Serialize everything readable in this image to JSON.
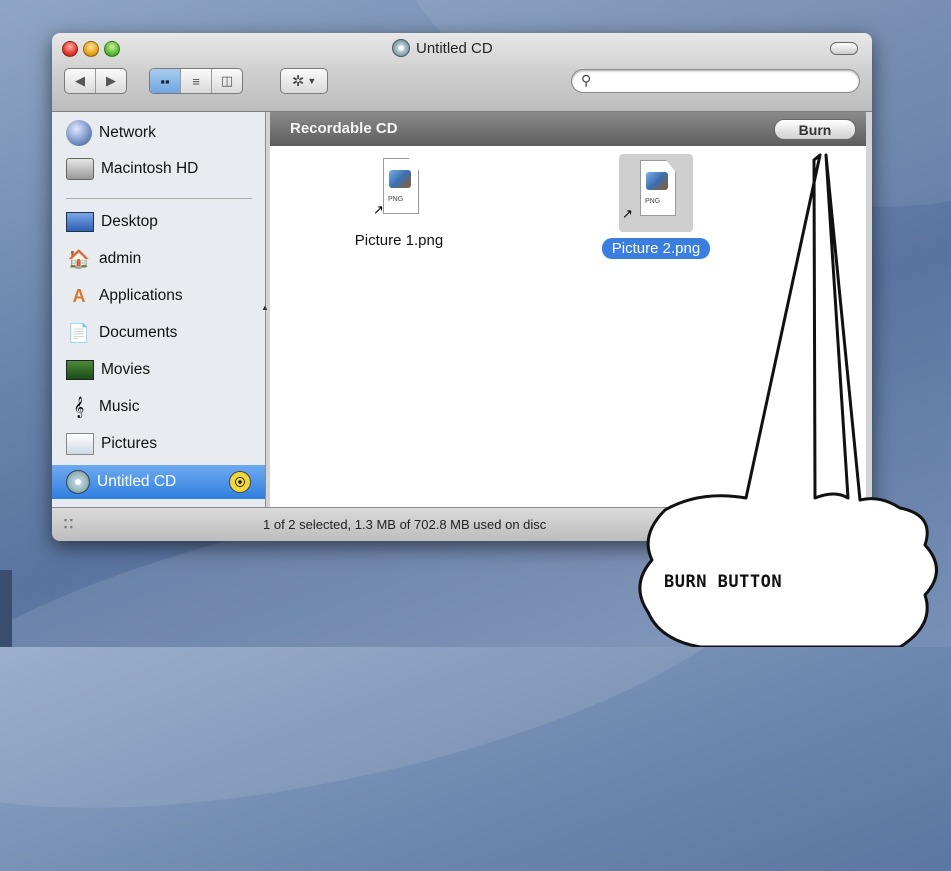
{
  "window": {
    "title": "Untitled CD"
  },
  "toolbar": {
    "back_icon": "back-arrow-icon",
    "forward_icon": "forward-arrow-icon",
    "view_modes": [
      "icon-view-icon",
      "list-view-icon",
      "column-view-icon"
    ],
    "selected_view": "icon-view-icon",
    "action_icon": "gear-icon",
    "search_placeholder": ""
  },
  "sidebar": {
    "items": [
      {
        "label": "Network",
        "icon": "network-globe-icon"
      },
      {
        "label": "Macintosh HD",
        "icon": "hard-drive-icon"
      },
      {
        "label": "Desktop",
        "icon": "desktop-icon"
      },
      {
        "label": "admin",
        "icon": "home-icon"
      },
      {
        "label": "Applications",
        "icon": "applications-icon"
      },
      {
        "label": "Documents",
        "icon": "documents-icon"
      },
      {
        "label": "Movies",
        "icon": "movies-icon"
      },
      {
        "label": "Music",
        "icon": "music-icon"
      },
      {
        "label": "Pictures",
        "icon": "pictures-icon"
      },
      {
        "label": "Untitled CD",
        "icon": "cd-icon",
        "selected": true,
        "accessory_icon": "burn-radiation-icon"
      }
    ]
  },
  "content": {
    "header": "Recordable CD",
    "burn_label": "Burn",
    "files": [
      {
        "name": "Picture 1.png",
        "type_label": "PNG",
        "selected": false
      },
      {
        "name": "Picture 2.png",
        "type_label": "PNG",
        "selected": true
      }
    ]
  },
  "status": {
    "text": "1 of 2 selected, 1.3 MB of 702.8 MB used on disc"
  },
  "annotation": {
    "text": "BURN BUTTON"
  },
  "colors": {
    "selection": "#3a7ee0",
    "header_bar": "#6e6e6e",
    "desktop": "#6d86ad"
  }
}
